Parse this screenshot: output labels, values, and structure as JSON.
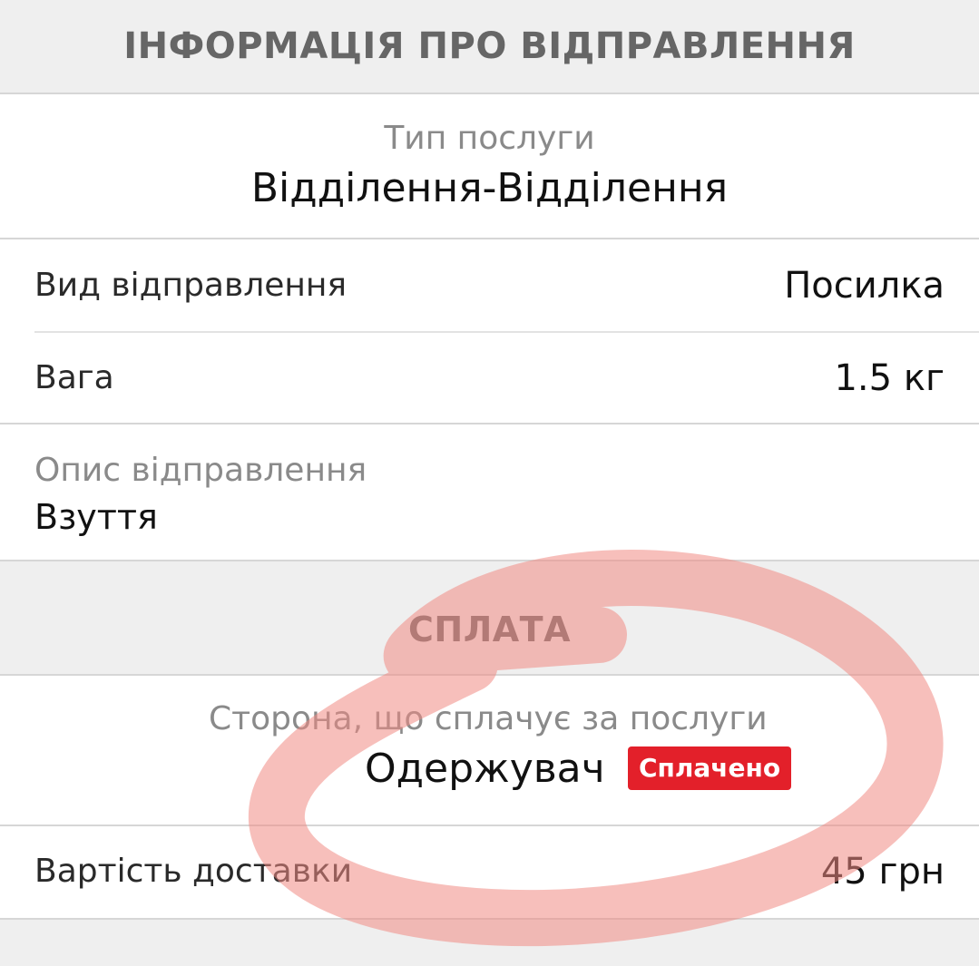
{
  "shipment_section": {
    "title": "ІНФОРМАЦІЯ ПРО ВІДПРАВЛЕННЯ",
    "service_type_label": "Тип послуги",
    "service_type_value": "Відділення-Відділення",
    "shipment_kind_label": "Вид відправлення",
    "shipment_kind_value": "Посилка",
    "weight_label": "Вага",
    "weight_value": "1.5 кг",
    "description_label": "Опис відправлення",
    "description_value": "Взуття"
  },
  "payment_section": {
    "title": "СПЛАТА",
    "payer_label": "Сторона, що сплачує за послуги",
    "payer_value": "Одержувач",
    "status_badge": "Сплачено",
    "delivery_cost_label": "Вартість доставки",
    "delivery_cost_value": "45 грн"
  },
  "colors": {
    "badge": "#e3202a",
    "annotation": "#f08a84",
    "background": "#efefef"
  }
}
